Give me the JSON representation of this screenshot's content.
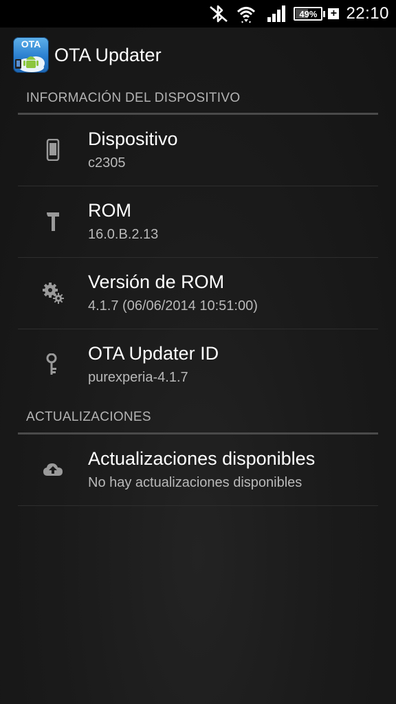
{
  "status_bar": {
    "icons": [
      "bluetooth-off-icon",
      "wifi-icon",
      "signal-icon"
    ],
    "battery_percent": "49%",
    "battery_level": 0.49,
    "charging": true,
    "time": "22:10"
  },
  "app": {
    "icon_text": "OTA",
    "title": "OTA Updater"
  },
  "sections": [
    {
      "header": "INFORMACIÓN DEL DISPOSITIVO",
      "items": [
        {
          "icon": "phone-icon",
          "title": "Dispositivo",
          "summary": "c2305"
        },
        {
          "icon": "hammer-icon",
          "title": "ROM",
          "summary": "16.0.B.2.13"
        },
        {
          "icon": "gears-icon",
          "title": "Versión de ROM",
          "summary": "4.1.7 (06/06/2014 10:51:00)"
        },
        {
          "icon": "key-icon",
          "title": "OTA Updater ID",
          "summary": "purexperia-4.1.7"
        }
      ]
    },
    {
      "header": "ACTUALIZACIONES",
      "items": [
        {
          "icon": "cloud-upload-icon",
          "title": "Actualizaciones disponibles",
          "summary": "No hay actualizaciones disponibles"
        }
      ]
    }
  ],
  "colors": {
    "background": "#161616",
    "status_bar": "#000000",
    "section_header": "#b4b4b4",
    "summary_text": "#b9b9b9",
    "icon_gray": "#9a9a9a"
  }
}
